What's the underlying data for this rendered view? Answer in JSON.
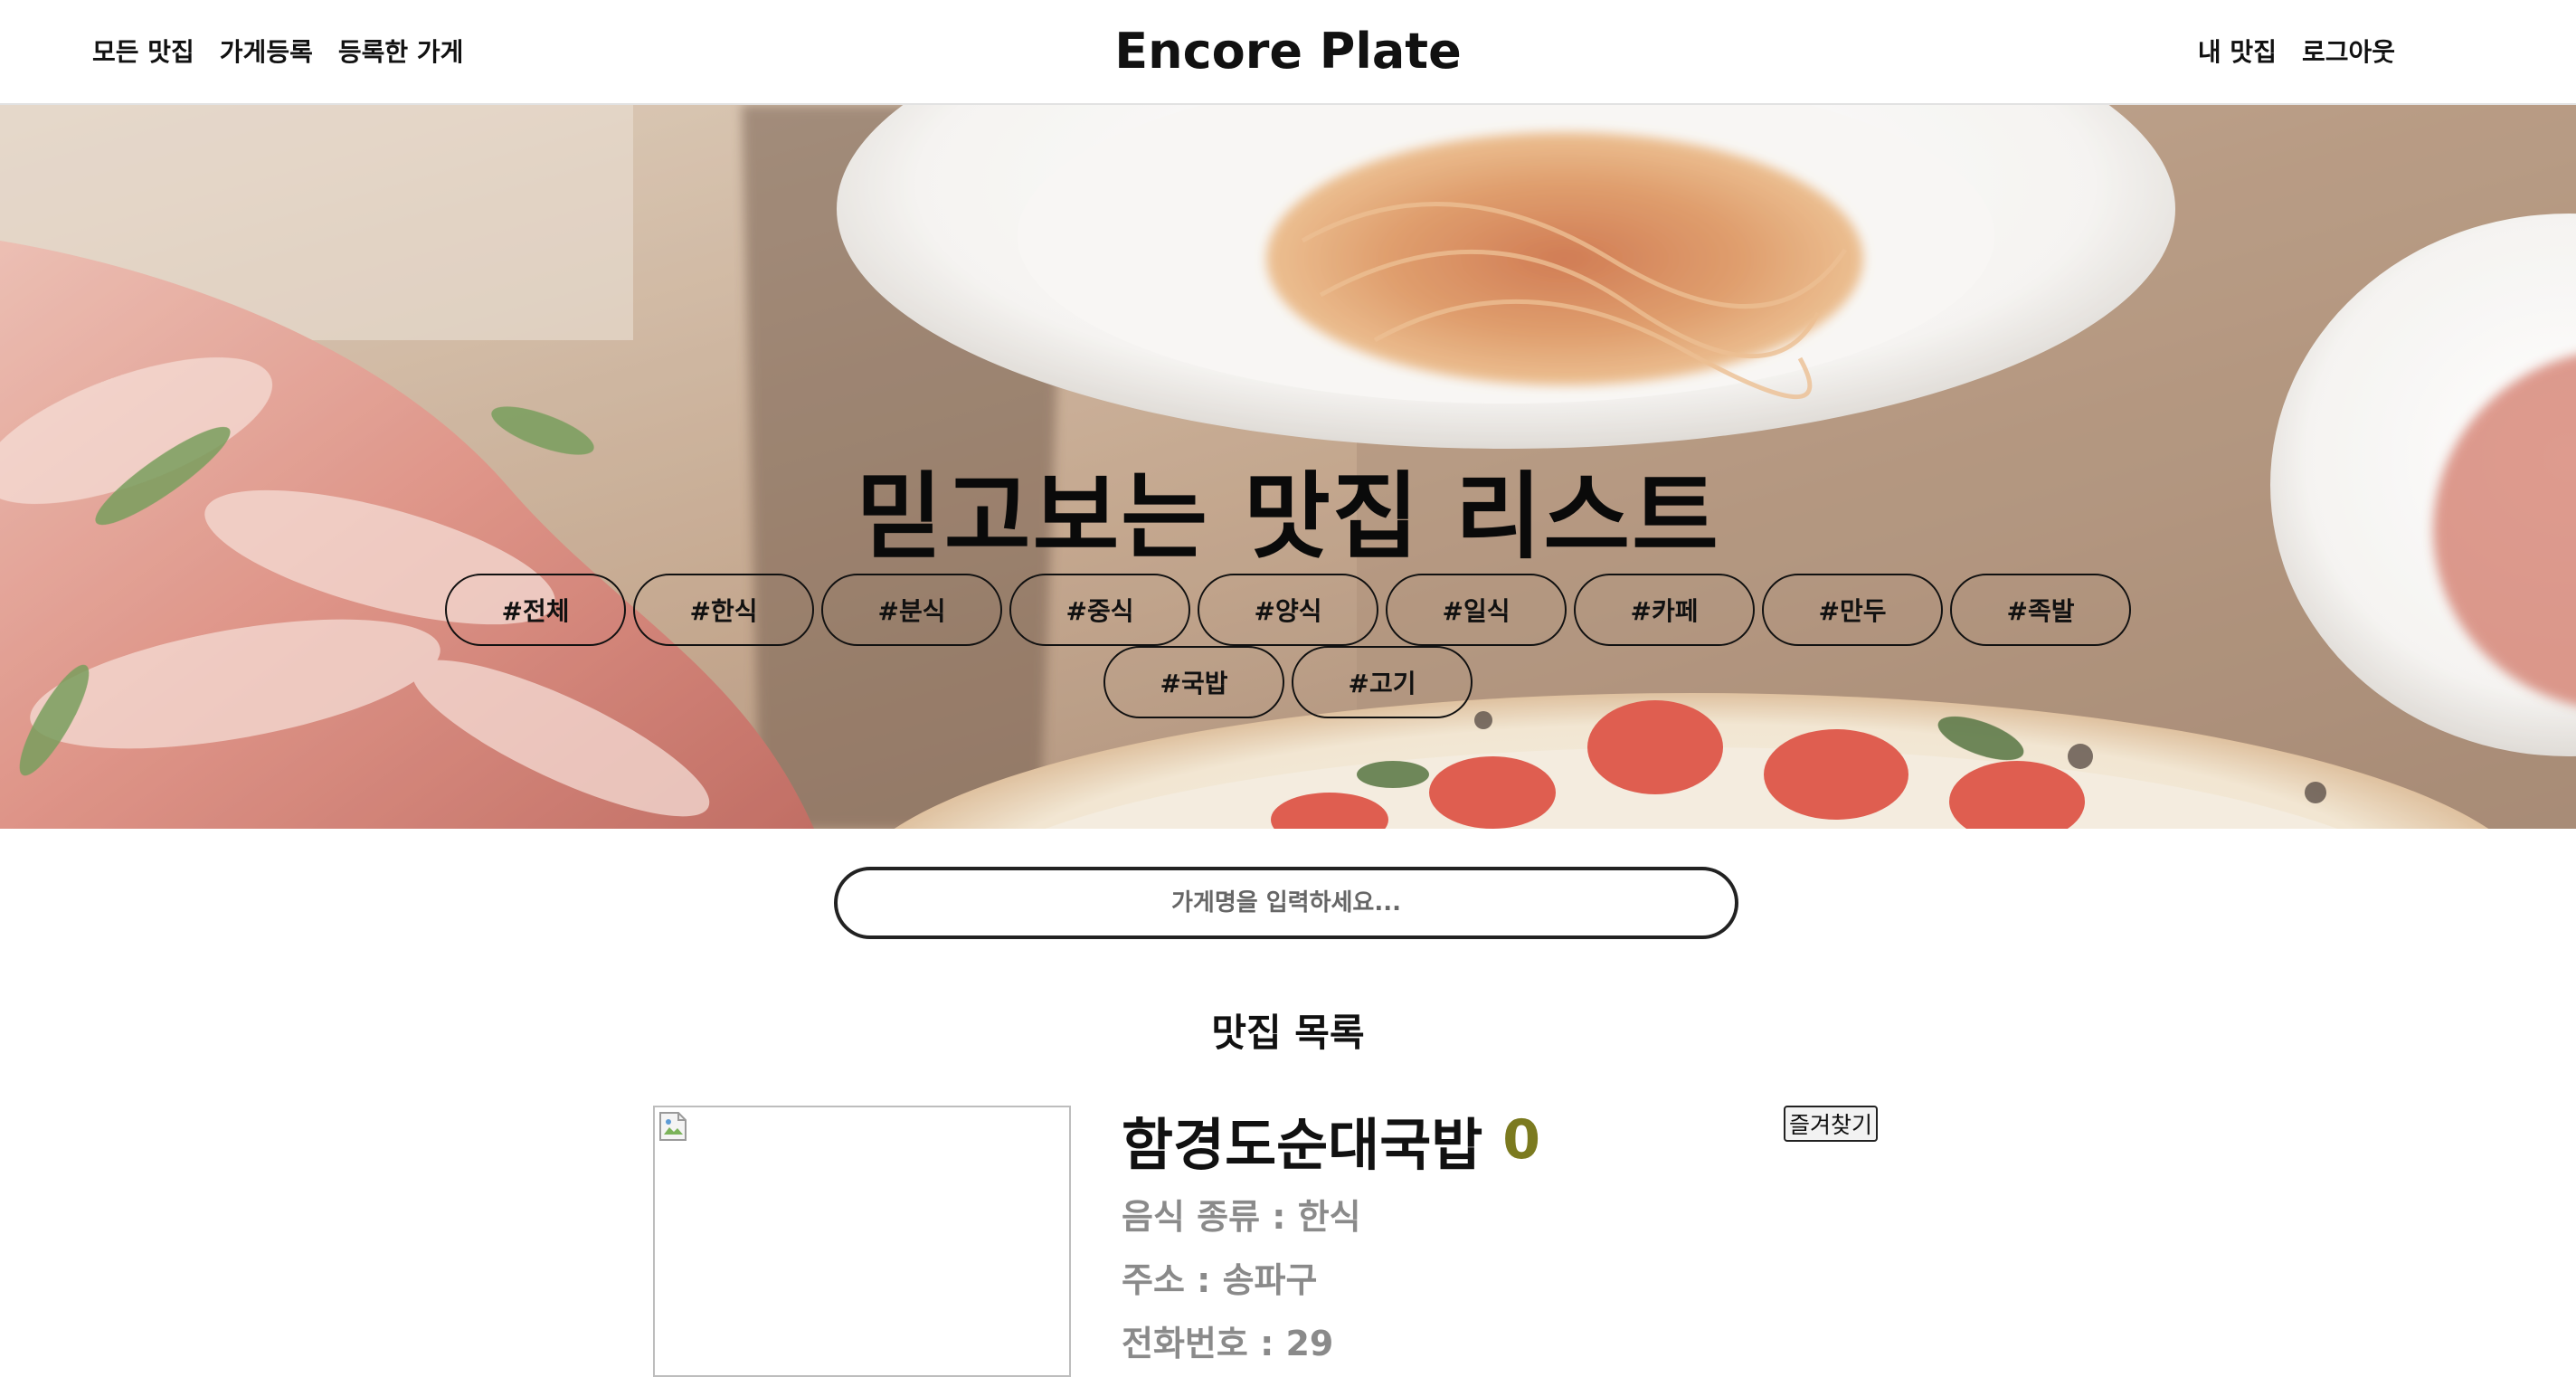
{
  "nav": {
    "left_links": [
      "모든 맛집",
      "가게등록",
      "등록한 가게"
    ],
    "brand": "Encore Plate",
    "right_links": [
      "내 맛집",
      "로그아웃"
    ]
  },
  "hero": {
    "title": "믿고보는 맛집 리스트",
    "tags": [
      "#전체",
      "#한식",
      "#분식",
      "#중식",
      "#양식",
      "#일식",
      "#카페",
      "#만두",
      "#족발",
      "#국밥",
      "#고기"
    ]
  },
  "search": {
    "placeholder": "가게명을 입력하세요..."
  },
  "list": {
    "title": "맛집 목록",
    "items": [
      {
        "name": "함경도순대국밥",
        "rating": "0",
        "category": "음식 종류 : 한식",
        "address": "주소 : 송파구",
        "phone": "전화번호 : 29",
        "favorite_label": "즐겨찾기"
      }
    ]
  },
  "colors": {
    "rating": "#7b7a1f",
    "meta_text": "#8a8a8a",
    "nav_border": "#e2e2e2"
  }
}
